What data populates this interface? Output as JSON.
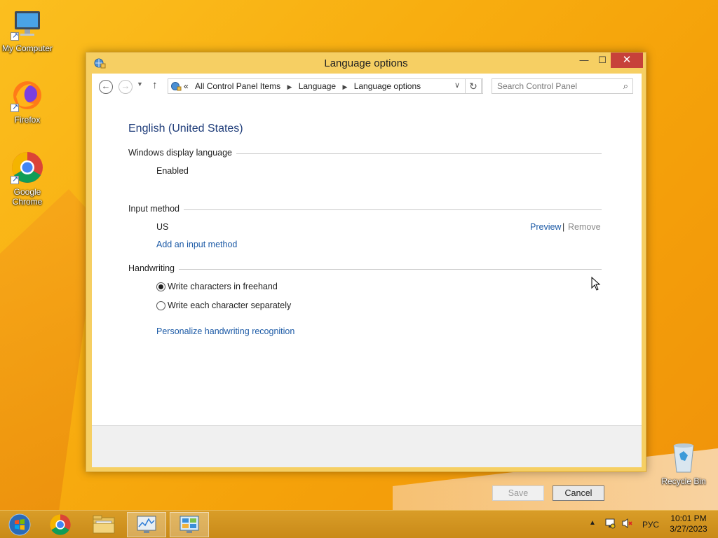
{
  "desktop": {
    "icons": [
      {
        "label": "My Computer"
      },
      {
        "label": "Firefox"
      },
      {
        "label": "Google Chrome"
      },
      {
        "label": "Recycle Bin"
      }
    ]
  },
  "window": {
    "title": "Language options",
    "controls": {
      "minimize": "—",
      "maximize": "☐",
      "close": "✕"
    }
  },
  "nav": {
    "breadcrumb_prefix": "«",
    "breadcrumbs": [
      "All Control Panel Items",
      "Language",
      "Language options"
    ],
    "search_placeholder": "Search Control Panel"
  },
  "content": {
    "language_name": "English (United States)",
    "display_language": {
      "heading": "Windows display language",
      "status": "Enabled"
    },
    "input_method": {
      "heading": "Input method",
      "method": "US",
      "preview": "Preview",
      "separator": "|",
      "remove": "Remove",
      "add": "Add an input method"
    },
    "handwriting": {
      "heading": "Handwriting",
      "options": [
        "Write characters in freehand",
        "Write each character separately"
      ],
      "selected_index": 0,
      "personalize": "Personalize handwriting recognition"
    }
  },
  "footer": {
    "save": "Save",
    "cancel": "Cancel"
  },
  "taskbar": {
    "language": "РУС",
    "time": "10:01 PM",
    "date": "3/27/2023"
  },
  "colors": {
    "accent": "#f8ae10",
    "link": "#1c5aa6",
    "close": "#c7413a"
  }
}
